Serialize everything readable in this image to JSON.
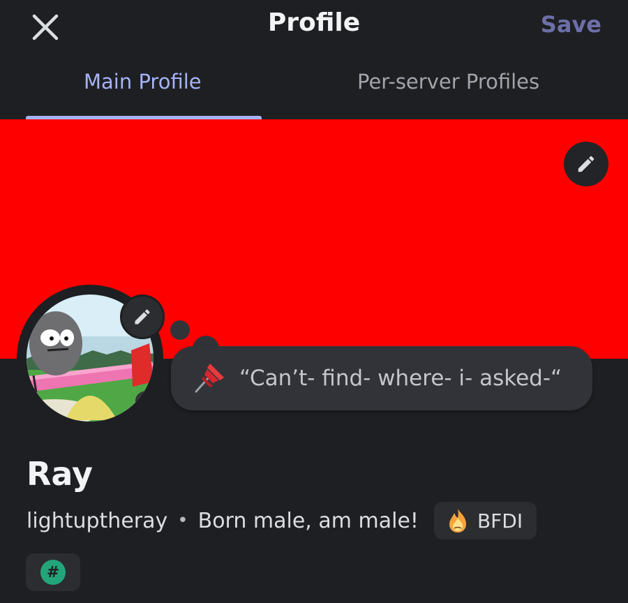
{
  "header": {
    "close_icon": "close-icon",
    "title": "Profile",
    "save_label": "Save"
  },
  "tabs": [
    {
      "label": "Main Profile",
      "active": true
    },
    {
      "label": "Per-server Profiles",
      "active": false
    }
  ],
  "banner": {
    "color": "#ff0000",
    "edit_icon": "pencil-icon"
  },
  "avatar": {
    "edit_icon": "pencil-icon"
  },
  "status": {
    "emoji": "pushpin-icon",
    "text": "“Can’t- find- where- i- asked-“"
  },
  "profile": {
    "display_name": "Ray",
    "username": "lightuptheray",
    "separator": "•",
    "pronouns": "Born male, am male!",
    "tag": {
      "icon": "flame-icon",
      "label": "BFDI"
    }
  },
  "badge": {
    "icon": "hashtag-icon",
    "glyph": "#",
    "color": "#23a57a"
  },
  "colors": {
    "background": "#1e1f22",
    "accent": "#a5b3f7",
    "save": "#6d6fa8",
    "bubble": "#323338"
  }
}
